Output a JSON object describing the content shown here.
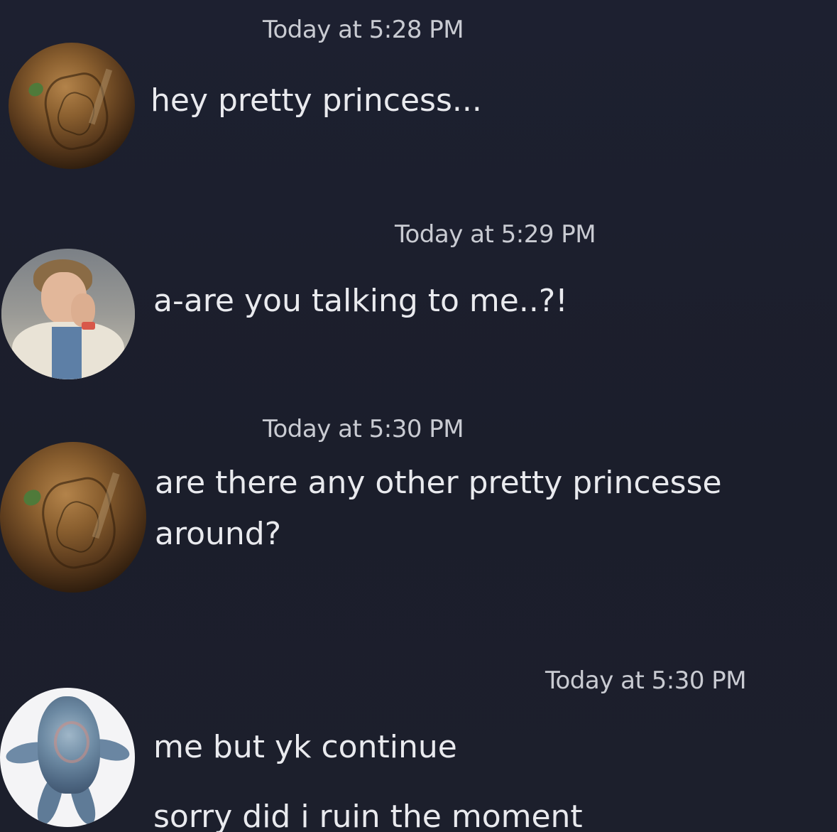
{
  "messages": [
    {
      "avatar_icon": "rock-avatar-icon",
      "timestamp": "Today at 5:28 PM",
      "lines": [
        "hey pretty princess..."
      ]
    },
    {
      "avatar_icon": "person-avatar-icon",
      "timestamp": "Today at 5:29 PM",
      "lines": [
        "a-are you talking to me..?!"
      ]
    },
    {
      "avatar_icon": "rock-avatar-icon",
      "timestamp": "Today at 5:30 PM",
      "lines": [
        "are there any other pretty princesse",
        "around?"
      ]
    },
    {
      "avatar_icon": "creature-avatar-icon",
      "timestamp": "Today at 5:30 PM",
      "lines": [
        "me but yk continue",
        "sorry did i ruin the moment"
      ]
    }
  ],
  "colors": {
    "background": "#1c1f2c",
    "timestamp_text": "#c9cbd2",
    "message_text": "#e9eaee"
  }
}
